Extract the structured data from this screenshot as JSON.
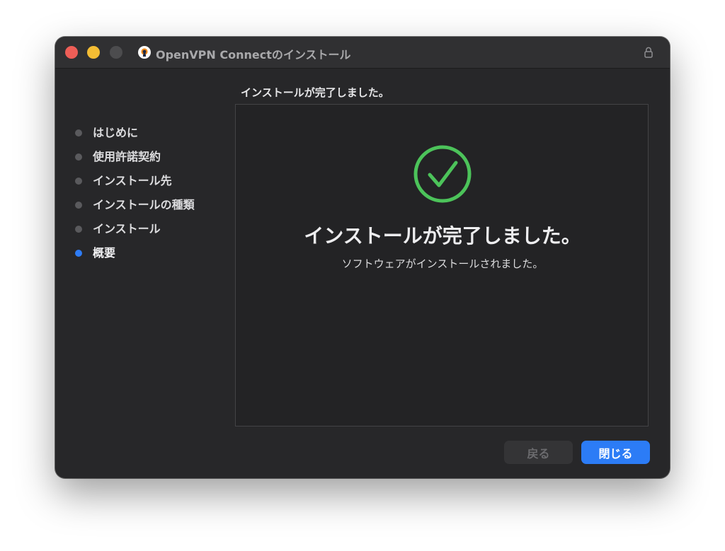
{
  "window": {
    "title": "OpenVPN Connectのインストール"
  },
  "header": {
    "text": "インストールが完了しました。"
  },
  "sidebar": {
    "items": [
      {
        "label": "はじめに",
        "active": false
      },
      {
        "label": "使用許諾契約",
        "active": false
      },
      {
        "label": "インストール先",
        "active": false
      },
      {
        "label": "インストールの種類",
        "active": false
      },
      {
        "label": "インストール",
        "active": false
      },
      {
        "label": "概要",
        "active": true
      }
    ]
  },
  "main": {
    "title": "インストールが完了しました。",
    "subtitle": "ソフトウェアがインストールされました。",
    "icon": "checkmark-circle-icon"
  },
  "buttons": {
    "back_label": "戻る",
    "close_label": "閉じる"
  },
  "colors": {
    "accent": "#2c7cf6",
    "success": "#4cc35a",
    "window_bg": "#272729",
    "traffic_close": "#ee5e57",
    "traffic_minimize": "#f4bd34",
    "traffic_maximize": "#4c4c4e"
  }
}
